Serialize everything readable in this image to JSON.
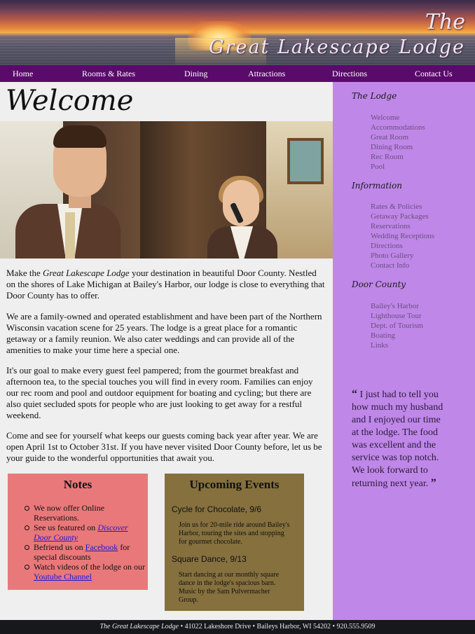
{
  "banner": {
    "title_the": "The",
    "title_main": "Great Lakescape Lodge"
  },
  "nav": {
    "items": [
      {
        "label": "Home"
      },
      {
        "label": "Rooms & Rates"
      },
      {
        "label": "Dining"
      },
      {
        "label": "Attractions"
      },
      {
        "label": "Directions"
      },
      {
        "label": "Contact Us"
      }
    ]
  },
  "main": {
    "heading": "Welcome",
    "para1_pre": "Make the ",
    "para1_em": "Great Lakescape Lodge",
    "para1_post": " your destination in beautiful Door County. Nestled on the shores of Lake Michigan at Bailey's Harbor, our lodge is close to everything that Door County has to offer.",
    "para2": "We are a family-owned and operated establishment and have been part of the Northern Wisconsin vacation scene for 25 years. The lodge is a great place for a romantic getaway or a family reunion. We also cater weddings and can provide all of the amenities to make your time here a special one.",
    "para3": "It's our goal to make every guest feel pampered; from the gourmet breakfast and afternoon tea, to the special touches you will find in every room. Families can enjoy our rec room and pool and outdoor equipment for boating and cycling; but there are also quiet secluded spots for people who are just looking to get away for a restful weekend.",
    "para4": "Come and see for yourself what keeps our guests coming back year after year. We are open April 1st to October 31st. If you have never visited Door County before, let us be your guide to the wonderful opportunities that await you."
  },
  "notes": {
    "title": "Notes",
    "item1": "We now offer Online Reservations.",
    "item2_pre": "See us featured on ",
    "item2_link": "Discover Door County",
    "item3_pre": "Befriend us on ",
    "item3_link": "Facebook",
    "item3_post": " for special discounts",
    "item4_pre": "Watch videos of the lodge on our ",
    "item4_link": "Youtube Channel"
  },
  "events": {
    "title": "Upcoming Events",
    "items": [
      {
        "title": "Cycle for Chocolate, 9/6",
        "desc": "Join us for 20-mile ride around Bailey's Harbor, touring the sites and stopping for gourmet chocolate."
      },
      {
        "title": "Square Dance, 9/13",
        "desc": "Start dancing at our monthly square dance in the lodge's spacious barn. Music by the Sam Pulvermacher Group."
      }
    ]
  },
  "sidebar": {
    "sections": [
      {
        "heading": "The Lodge",
        "items": [
          "Welcome",
          "Accommodations",
          "Great Room",
          "Dining Room",
          "Rec Room",
          "Pool"
        ]
      },
      {
        "heading": "Information",
        "items": [
          "Rates & Policies",
          "Getaway Packages",
          "Reservations",
          "Wedding Receptions",
          "Directions",
          "Photo Gallery",
          "Contact Info"
        ]
      },
      {
        "heading": "Door County",
        "items": [
          "Bailey's Harbor",
          "Lighthouse Tour",
          "Dept. of Tourism",
          "Boating",
          "Links"
        ]
      }
    ],
    "quote_open": "“",
    "quote": " I just had to tell you how much my husband and I enjoyed our time at the lodge. The food was excellent and the service was top notch. We look forward to returning next year. ",
    "quote_close": "”"
  },
  "footer": {
    "name": "The Great Lakescape Lodge",
    "rest": " • 41022 Lakeshore Drive • Baileys Harbor, WI 54202 • 920.555.9509"
  },
  "colors": {
    "nav_bg": "#5a0a6b",
    "sidebar_bg": "#bf87e8",
    "notes_bg": "#e9787a",
    "events_bg": "#85703e",
    "footer_bg": "#16181c",
    "content_bg": "#efefef"
  }
}
